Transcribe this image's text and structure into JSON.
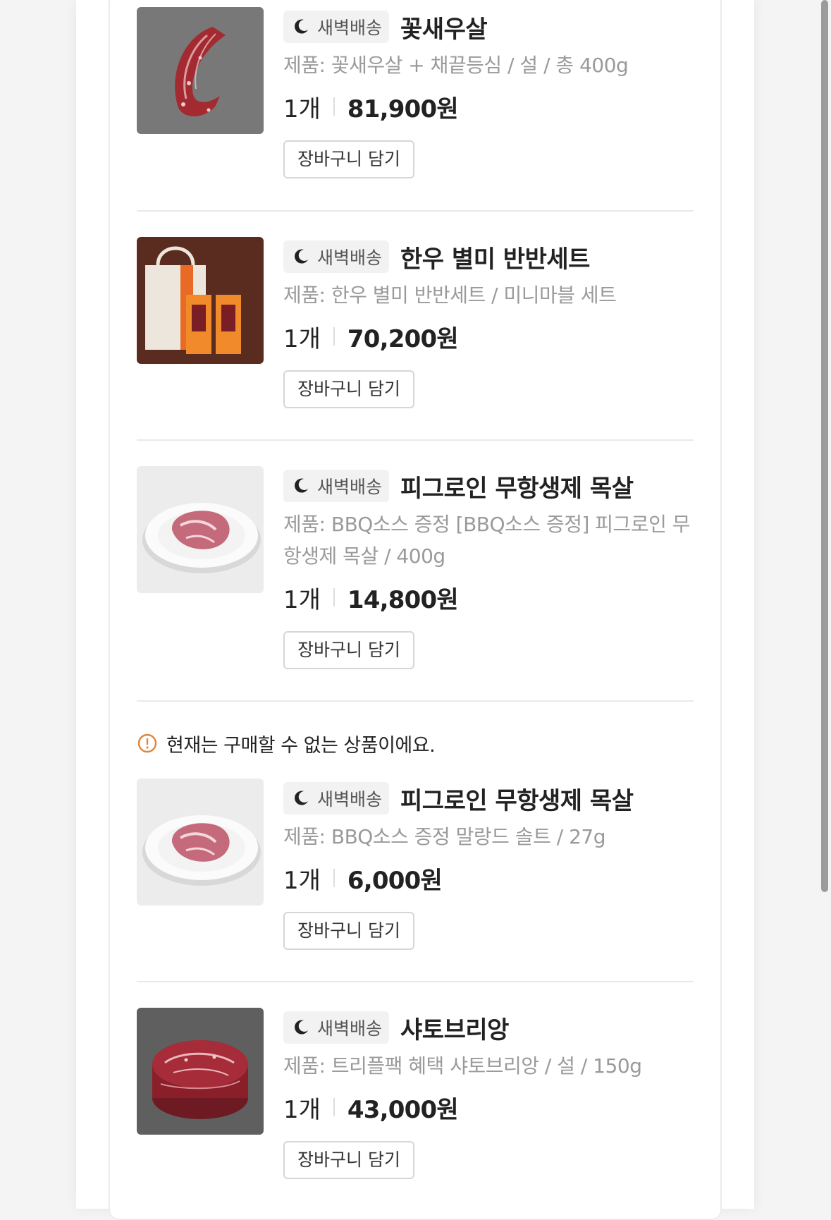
{
  "delivery_badge": "새벽배송",
  "notice": "현재는 구매할 수 없는 상품이에요.",
  "colors": {
    "notice_accent": "#e0863a",
    "badge_bg": "#f2f2f2"
  },
  "items": [
    {
      "title": "꽃새우살",
      "detail": "제품: 꽃새우살 + 채끝등심 / 설 / 총 400g",
      "qty": "1개",
      "price": "81,900원",
      "cart_label": "장바구니 담기",
      "image": "marbled-beef-strip"
    },
    {
      "title": "한우 별미 반반세트",
      "detail": "제품: 한우 별미 반반세트 / 미니마블 세트",
      "qty": "1개",
      "price": "70,200원",
      "cart_label": "장바구니 담기",
      "image": "gift-bag-set"
    },
    {
      "title": "피그로인 무항생제 목살",
      "detail": "제품: BBQ소스 증정 [BBQ소스 증정] 피그로인 무항생제 목살 / 400g",
      "qty": "1개",
      "price": "14,800원",
      "cart_label": "장바구니 담기",
      "image": "pork-neck-plate"
    },
    {
      "title": "피그로인 무항생제 목살",
      "detail": "제품: BBQ소스 증정 말랑드 솔트 / 27g",
      "qty": "1개",
      "price": "6,000원",
      "cart_label": "장바구니 담기",
      "image": "pork-neck-plate"
    },
    {
      "title": "샤토브리앙",
      "detail": "제품: 트리플팩 혜택 샤토브리앙 / 설 / 150g",
      "qty": "1개",
      "price": "43,000원",
      "cart_label": "장바구니 담기",
      "image": "chateaubriand-steak"
    }
  ]
}
